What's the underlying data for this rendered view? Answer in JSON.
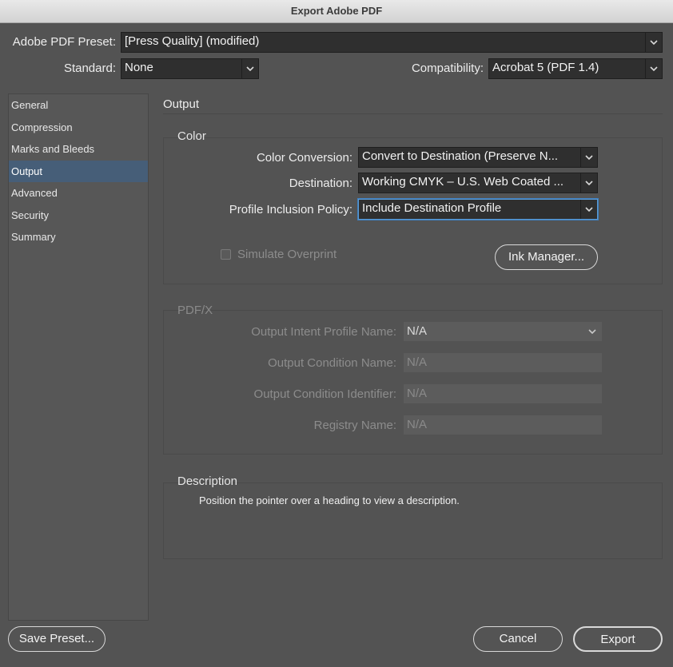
{
  "window": {
    "title": "Export Adobe PDF"
  },
  "header": {
    "preset_label": "Adobe PDF Preset:",
    "preset_value": "[Press Quality] (modified)",
    "standard_label": "Standard:",
    "standard_value": "None",
    "compat_label": "Compatibility:",
    "compat_value": "Acrobat 5 (PDF 1.4)"
  },
  "sidebar": {
    "items": [
      {
        "label": "General"
      },
      {
        "label": "Compression"
      },
      {
        "label": "Marks and Bleeds"
      },
      {
        "label": "Output",
        "selected": true
      },
      {
        "label": "Advanced"
      },
      {
        "label": "Security"
      },
      {
        "label": "Summary"
      }
    ]
  },
  "main": {
    "section_title": "Output",
    "color": {
      "title": "Color",
      "conversion_label": "Color Conversion:",
      "conversion_value": "Convert to Destination (Preserve N...",
      "destination_label": "Destination:",
      "destination_value": "Working CMYK – U.S. Web Coated ...",
      "policy_label": "Profile Inclusion Policy:",
      "policy_value": "Include Destination Profile",
      "simulate_label": "Simulate Overprint",
      "simulate_checked": false,
      "ink_manager_label": "Ink Manager..."
    },
    "pdfx": {
      "title": "PDF/X",
      "intent_label": "Output Intent Profile Name:",
      "intent_value": "N/A",
      "condition_name_label": "Output Condition Name:",
      "condition_name_value": "N/A",
      "condition_id_label": "Output Condition Identifier:",
      "condition_id_value": "N/A",
      "registry_label": "Registry Name:",
      "registry_value": "N/A"
    },
    "description": {
      "title": "Description",
      "text": "Position the pointer over a heading to view a description."
    }
  },
  "footer": {
    "save_preset_label": "Save Preset...",
    "cancel_label": "Cancel",
    "export_label": "Export"
  },
  "colors": {
    "background": "#535353",
    "field": "#2f2f2f",
    "selection": "#465e78",
    "focus": "#5b9bd5"
  }
}
